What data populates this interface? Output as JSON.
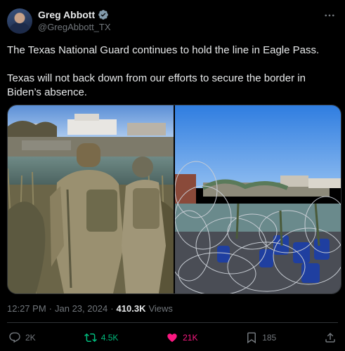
{
  "author": {
    "display_name": "Greg Abbott",
    "handle": "@GregAbbott_TX",
    "verified_icon": "verified-badge-icon"
  },
  "tweet": {
    "paragraphs": [
      "The Texas National Guard continues to hold the line in Eagle Pass.",
      "Texas will not back down from our efforts to secure the border in Biden’s absence."
    ]
  },
  "meta": {
    "time": "12:27 PM",
    "separator": "·",
    "date": "Jan 23, 2024",
    "views_count": "410.3K",
    "views_label": "Views"
  },
  "actions": {
    "replies": "2K",
    "retweets": "4.5K",
    "likes": "21K",
    "bookmarks": "185"
  },
  "colors": {
    "background": "#000000",
    "text": "#e7e9ea",
    "muted": "#71767b",
    "retweet": "#00ba7c",
    "like": "#f91880",
    "verified": "#829aab"
  }
}
